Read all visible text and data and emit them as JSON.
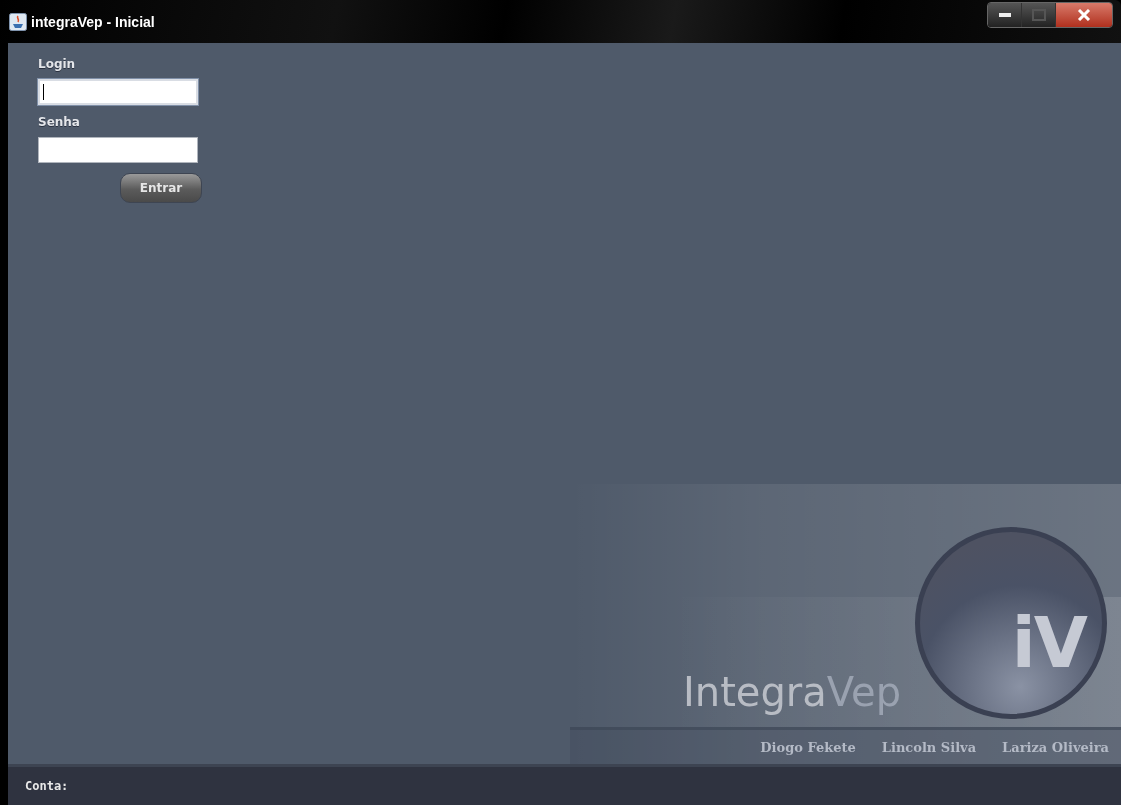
{
  "window": {
    "title": "integraVep - Inicial"
  },
  "form": {
    "fields": [
      {
        "label": "Login",
        "focused": true
      },
      {
        "label": "Senha",
        "focused": false
      }
    ],
    "button": "Entrar"
  },
  "logo": {
    "word_1": "Integra",
    "word_2": "Vep",
    "badge": "iV"
  },
  "credits": [
    "Diogo Fekete",
    "Lincoln Silva",
    "Lariza Oliveira"
  ],
  "status_bar": {
    "label": "Conta:"
  }
}
